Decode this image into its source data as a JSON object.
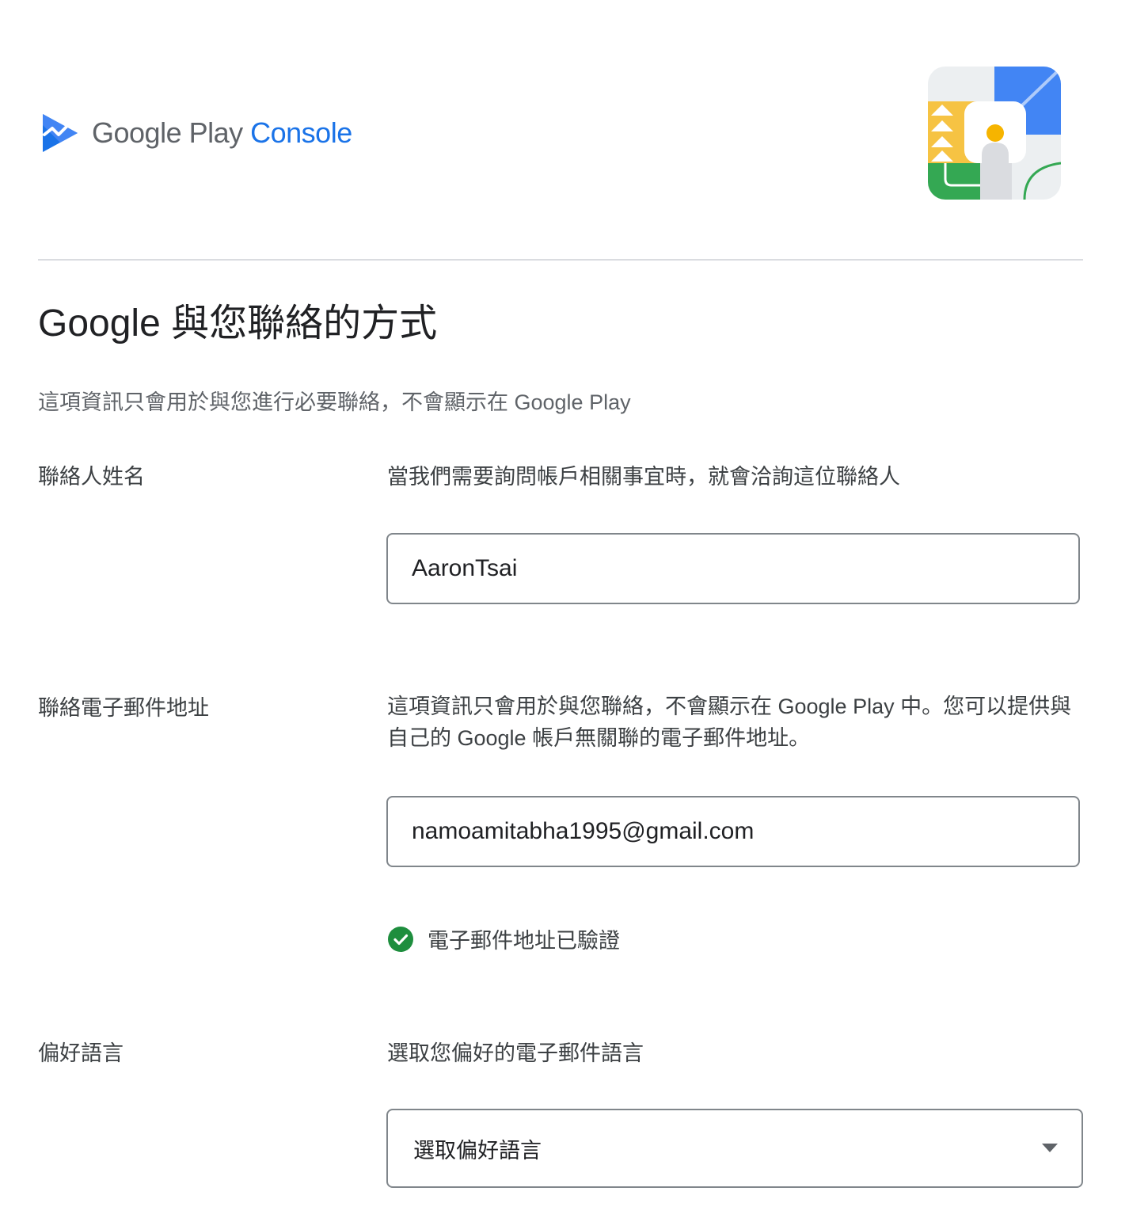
{
  "header": {
    "logo_google": "Google Play",
    "logo_console": "Console"
  },
  "page": {
    "title": "Google 與您聯絡的方式",
    "intro": "這項資訊只會用於與您進行必要聯絡，不會顯示在 Google Play"
  },
  "contact_name": {
    "label": "聯絡人姓名",
    "description": "當我們需要詢問帳戶相關事宜時，就會洽詢這位聯絡人",
    "value": "AaronTsai"
  },
  "contact_email": {
    "label": "聯絡電子郵件地址",
    "description": "這項資訊只會用於與您聯絡，不會顯示在 Google Play 中。您可以提供與自己的 Google 帳戶無關聯的電子郵件地址。",
    "value": "namoamitabha1995@gmail.com",
    "verified_text": "電子郵件地址已驗證"
  },
  "preferred_language": {
    "label": "偏好語言",
    "description": "選取您偏好的電子郵件語言",
    "selected": "選取偏好語言"
  },
  "icons": {
    "logo": "play-console-logo-icon",
    "illustration": "contact-card-illustration-icon",
    "verified": "check-circle-icon",
    "dropdown": "caret-down-icon"
  },
  "colors": {
    "accent": "#1a73e8",
    "verified_green": "#1e8e3e",
    "border": "#80868b"
  }
}
